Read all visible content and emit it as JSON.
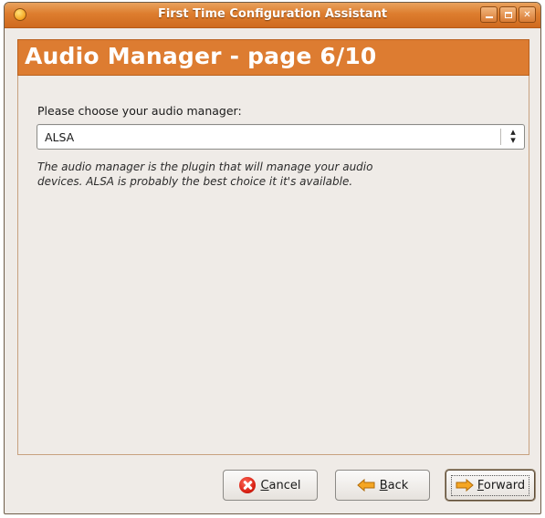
{
  "window": {
    "title": "First Time Configuration Assistant"
  },
  "header": {
    "title": "Audio Manager - page 6/10"
  },
  "content": {
    "prompt": "Please choose your audio manager:",
    "selected_audio_manager": "ALSA",
    "help_text": "The audio manager is the plugin that will manage your audio devices. ALSA is probably the best choice it it's available."
  },
  "buttons": {
    "cancel_mnemonic": "C",
    "cancel_rest": "ancel",
    "back_mnemonic": "B",
    "back_rest": "ack",
    "forward_mnemonic": "F",
    "forward_rest": "orward"
  },
  "icons": {
    "app": "app-icon",
    "minimize": "minimize-icon",
    "maximize": "maximize-icon",
    "close": "close-icon",
    "cancel": "cancel-icon",
    "back": "back-arrow-icon",
    "forward": "forward-arrow-icon",
    "combo": "combo-arrows-icon"
  },
  "colors": {
    "accent": "#dd7c31",
    "titlebar": "#dd7d2e",
    "window_bg": "#efebe7"
  }
}
